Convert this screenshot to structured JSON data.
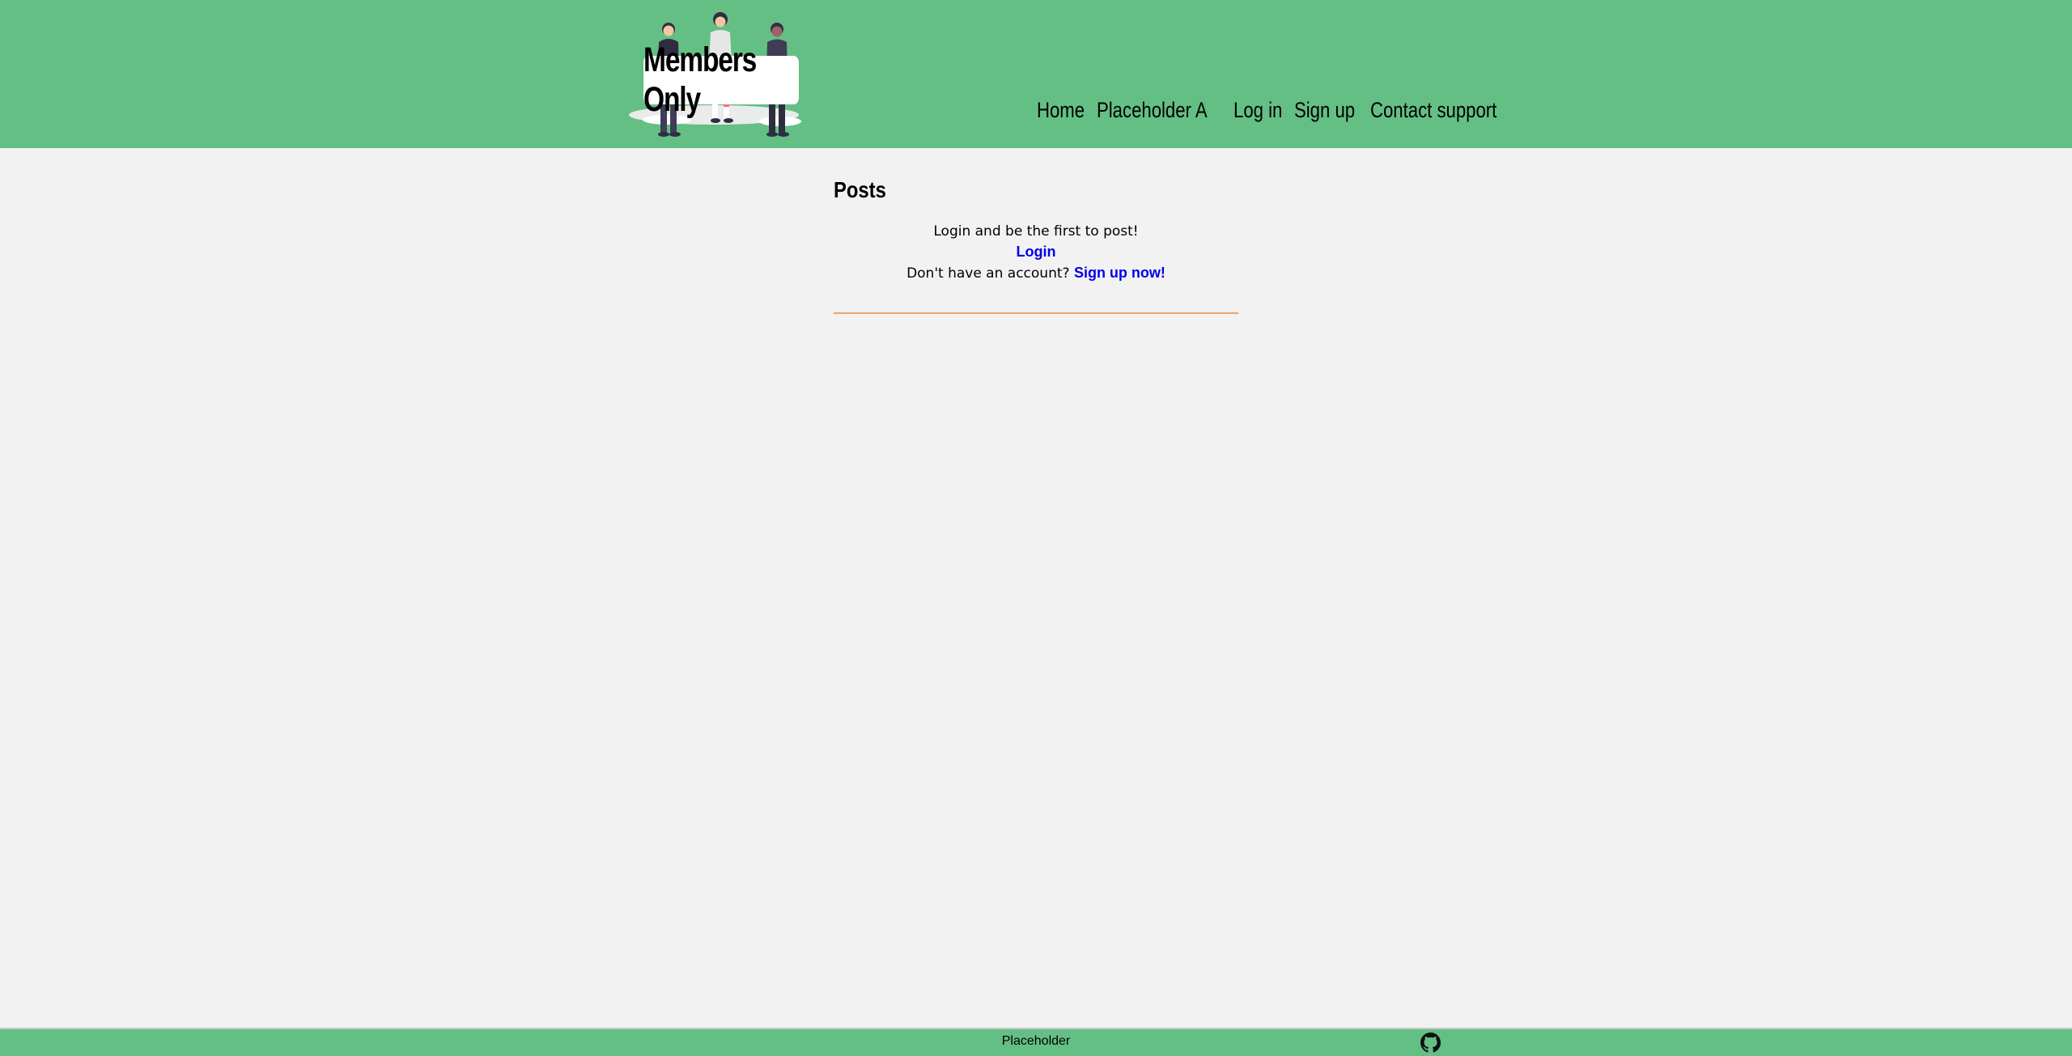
{
  "header": {
    "logo_text": "Members Only",
    "colors": {
      "header_bg": "#64bf85",
      "link": "#0000ee",
      "divider": "#e8a66e"
    }
  },
  "nav": {
    "items": [
      {
        "label": "Home"
      },
      {
        "label": "Placeholder A"
      },
      {
        "label": "Log in"
      },
      {
        "label": "Sign up"
      },
      {
        "label": "Contact support"
      }
    ]
  },
  "main": {
    "title": "Posts",
    "empty_message": "Login and be the first to post!",
    "login_link": "Login",
    "signup_prompt": "Don't have an account?",
    "signup_link": "Sign up now!"
  },
  "footer": {
    "text": "Placeholder",
    "icon": "github-icon"
  }
}
